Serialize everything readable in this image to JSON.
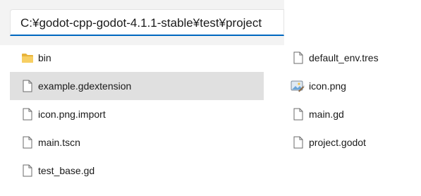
{
  "address_bar": {
    "path": "C:¥godot-cpp-godot-4.1.1-stable¥test¥project"
  },
  "files": [
    {
      "name": "bin",
      "icon": "folder-icon",
      "selected": false
    },
    {
      "name": "example.gdextension",
      "icon": "file-icon",
      "selected": true
    },
    {
      "name": "icon.png.import",
      "icon": "file-icon",
      "selected": false
    },
    {
      "name": "main.tscn",
      "icon": "file-icon",
      "selected": false
    },
    {
      "name": "test_base.gd",
      "icon": "file-icon",
      "selected": false
    },
    {
      "name": "default_env.tres",
      "icon": "file-icon",
      "selected": false
    },
    {
      "name": "icon.png",
      "icon": "image-file-icon",
      "selected": false
    },
    {
      "name": "main.gd",
      "icon": "file-icon",
      "selected": false
    },
    {
      "name": "project.godot",
      "icon": "file-icon",
      "selected": false
    }
  ],
  "colors": {
    "selection": "#e0e0e0",
    "accent": "#0067c0",
    "folder": "#f2c14e"
  }
}
